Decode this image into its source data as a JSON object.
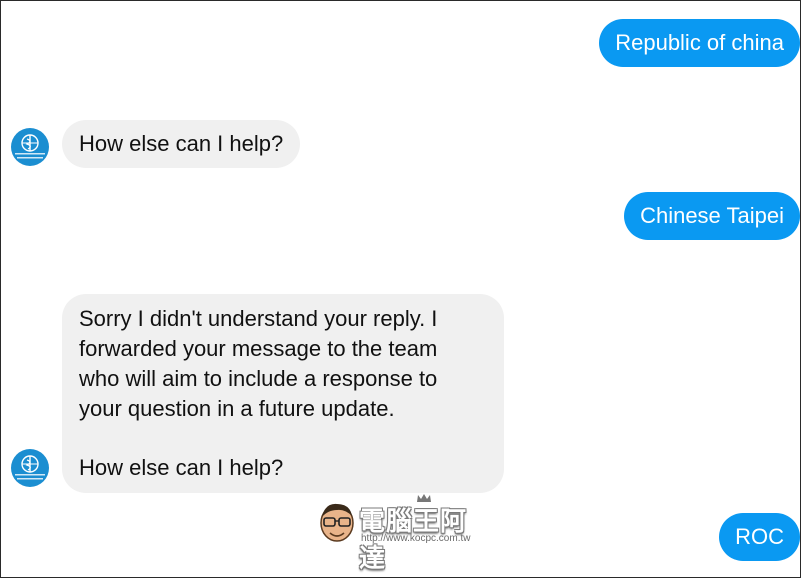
{
  "conversation": {
    "user_messages": [
      "Republic of china",
      "Chinese Taipei",
      "ROC"
    ],
    "bot_messages": {
      "reply_1": "How else can I help?",
      "reply_2_lines": [
        "Sorry I didn't understand your reply. I",
        "forwarded your message to the team",
        "who will aim to include a response to",
        "your question in a future update."
      ],
      "reply_2_tail": "How else can I help?"
    },
    "bot_avatar": {
      "icon": "who-logo-icon",
      "logo_text": "World Health Organization"
    }
  },
  "watermark": {
    "title": "電腦王阿達",
    "url": "http://www.kocpc.com.tw"
  },
  "colors": {
    "outgoing_bubble": "#0a99f2",
    "incoming_bubble": "#f0f0f0",
    "avatar_bg": "#1b8ed1"
  }
}
